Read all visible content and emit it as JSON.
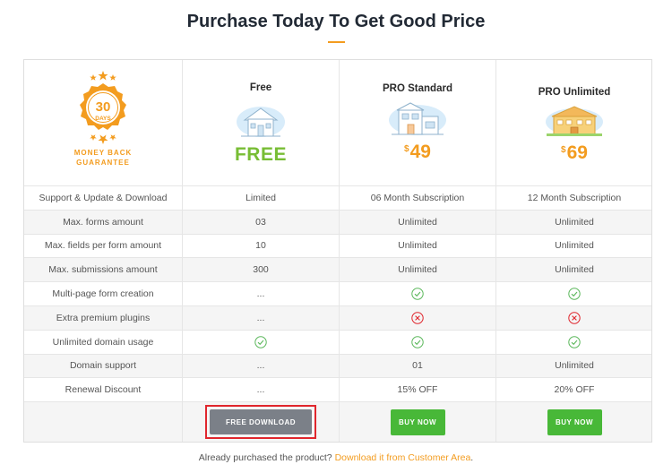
{
  "page": {
    "title": "Purchase Today To Get Good Price"
  },
  "badge": {
    "number": "30",
    "unit": "DAYS",
    "caption_line1": "MONEY BACK",
    "caption_line2": "GUARANTEE"
  },
  "plans": [
    {
      "name": "Free",
      "price_text": "FREE",
      "currency": "",
      "button_label": "FREE DOWNLOAD"
    },
    {
      "name": "PRO Standard",
      "price_text": "49",
      "currency": "$",
      "button_label": "BUY NOW"
    },
    {
      "name": "PRO Unlimited",
      "price_text": "69",
      "currency": "$",
      "button_label": "BUY NOW"
    }
  ],
  "features": [
    {
      "label": "Support & Update & Download",
      "values": [
        "Limited",
        "06 Month Subscription",
        "12 Month Subscription"
      ]
    },
    {
      "label": "Max. forms amount",
      "values": [
        "03",
        "Unlimited",
        "Unlimited"
      ]
    },
    {
      "label": "Max. fields per form amount",
      "values": [
        "10",
        "Unlimited",
        "Unlimited"
      ]
    },
    {
      "label": "Max. submissions amount",
      "values": [
        "300",
        "Unlimited",
        "Unlimited"
      ]
    },
    {
      "label": "Multi-page form creation",
      "values": [
        "...",
        "check",
        "check"
      ]
    },
    {
      "label": "Extra premium plugins",
      "values": [
        "...",
        "cross",
        "cross"
      ]
    },
    {
      "label": "Unlimited domain usage",
      "values": [
        "check",
        "check",
        "check"
      ]
    },
    {
      "label": "Domain support",
      "values": [
        "...",
        "01",
        "Unlimited"
      ]
    },
    {
      "label": "Renewal Discount",
      "values": [
        "...",
        "15% OFF",
        "20% OFF"
      ]
    }
  ],
  "footer": {
    "text": "Already purchased the product?",
    "link": "Download it from Customer Area",
    "end": "."
  },
  "colors": {
    "accent": "#f39c1f",
    "free_green": "#78bd35",
    "buy_button": "#48b838",
    "free_button": "#7b8088",
    "check": "#5cb85c",
    "cross": "#e0262d",
    "highlight_outline": "#e0262d"
  },
  "icons": {
    "check": "check-circle-icon",
    "cross": "x-circle-icon"
  }
}
